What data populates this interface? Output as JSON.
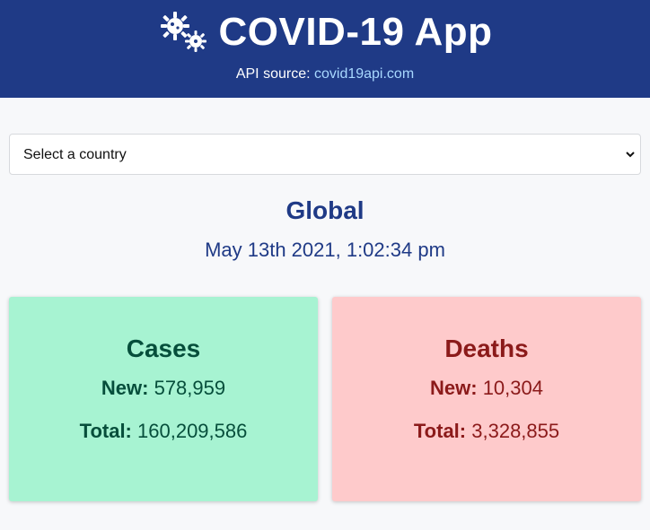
{
  "header": {
    "title": "COVID-19 App",
    "logo_icon": "virus-gears-icon",
    "api_prefix": "API source: ",
    "api_link_text": "covid19api.com",
    "colors": {
      "background": "#1f3a86",
      "link": "#a8d8ff"
    }
  },
  "selector": {
    "value": "Select a country",
    "chevron_icon": "chevron-down-icon"
  },
  "summary": {
    "region": "Global",
    "timestamp": "May 13th 2021, 1:02:34 pm"
  },
  "cards": {
    "cases": {
      "title": "Cases",
      "new_label": "New:",
      "new_value": "578,959",
      "total_label": "Total:",
      "total_value": "160,209,586",
      "background": "#a7f3d2",
      "text_color": "#064e3b"
    },
    "deaths": {
      "title": "Deaths",
      "new_label": "New:",
      "new_value": "10,304",
      "total_label": "Total:",
      "total_value": "3,328,855",
      "background": "#fecacb",
      "text_color": "#8b1a1a"
    }
  }
}
